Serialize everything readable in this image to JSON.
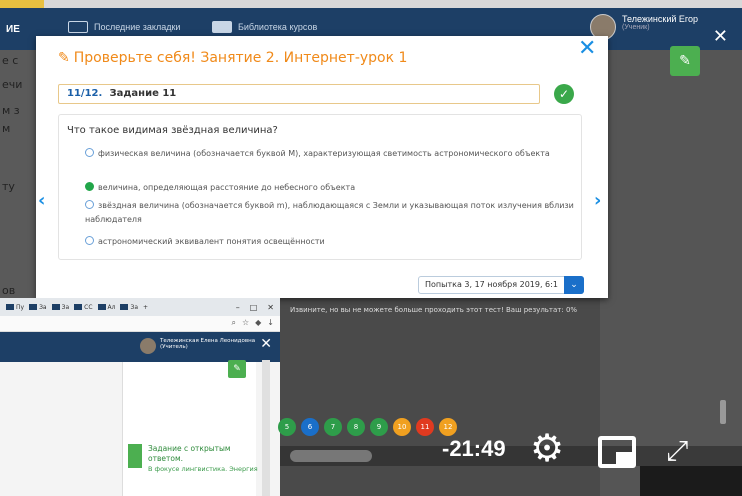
{
  "bg": {
    "brand": "ИЕ",
    "nav": [
      "Последние закладки",
      "Библиотека курсов"
    ],
    "user_name": "Тележинский Егор",
    "user_role": "(Ученик)",
    "left_fragments": [
      "е с",
      "ечи",
      "м з",
      "м",
      "ту",
      "ов"
    ]
  },
  "modal": {
    "title": "Проверьте себя! Занятие 2. Интернет-урок 1",
    "task_number": "11/12.",
    "task_label": "Задание 11",
    "question": "Что такое видимая звёздная величина?",
    "options": [
      {
        "text": "физическая величина (обозначается буквой M), характеризующая светимость астрономического объекта",
        "selected": false
      },
      {
        "text": "величина, определяющая расстояние до небесного объекта",
        "selected": true
      },
      {
        "text": "звёздная величина (обозначается буквой m), наблюдающаяся с Земли и указывающая поток излучения вблизи наблюдателя",
        "selected": false
      },
      {
        "text": "астрономический эквивалент понятия освещённости",
        "selected": false
      }
    ],
    "attempt": "Попытка 3, 17 ноября 2019, 6:1"
  },
  "notice": "Извините, но вы не можете больше проходить этот тест!   Ваш результат: 0%",
  "window": {
    "tabs": [
      "Пу",
      "За",
      "За",
      "СС",
      "Ал",
      "За"
    ],
    "user_name": "Тележинская Елена Леонидовна",
    "user_role": "(Учитель)",
    "task_title": "Задание с открытым ответом.",
    "task_sub": "В фокусе лингвистика. Энергия"
  },
  "dots": [
    {
      "n": "5",
      "color": "#2e9d4a"
    },
    {
      "n": "6",
      "color": "#1a6fc9"
    },
    {
      "n": "7",
      "color": "#2e9d4a"
    },
    {
      "n": "8",
      "color": "#2e9d4a"
    },
    {
      "n": "9",
      "color": "#2e9d4a"
    },
    {
      "n": "10",
      "color": "#f0a020"
    },
    {
      "n": "11",
      "color": "#e03a20"
    },
    {
      "n": "12",
      "color": "#f0a020"
    }
  ],
  "player": {
    "time": "-21:49"
  },
  "colors": {
    "header": "#1d3f66",
    "accent_blue": "#1a8fe3",
    "title_orange": "#f08a1a",
    "correct_green": "#3aa84a"
  }
}
